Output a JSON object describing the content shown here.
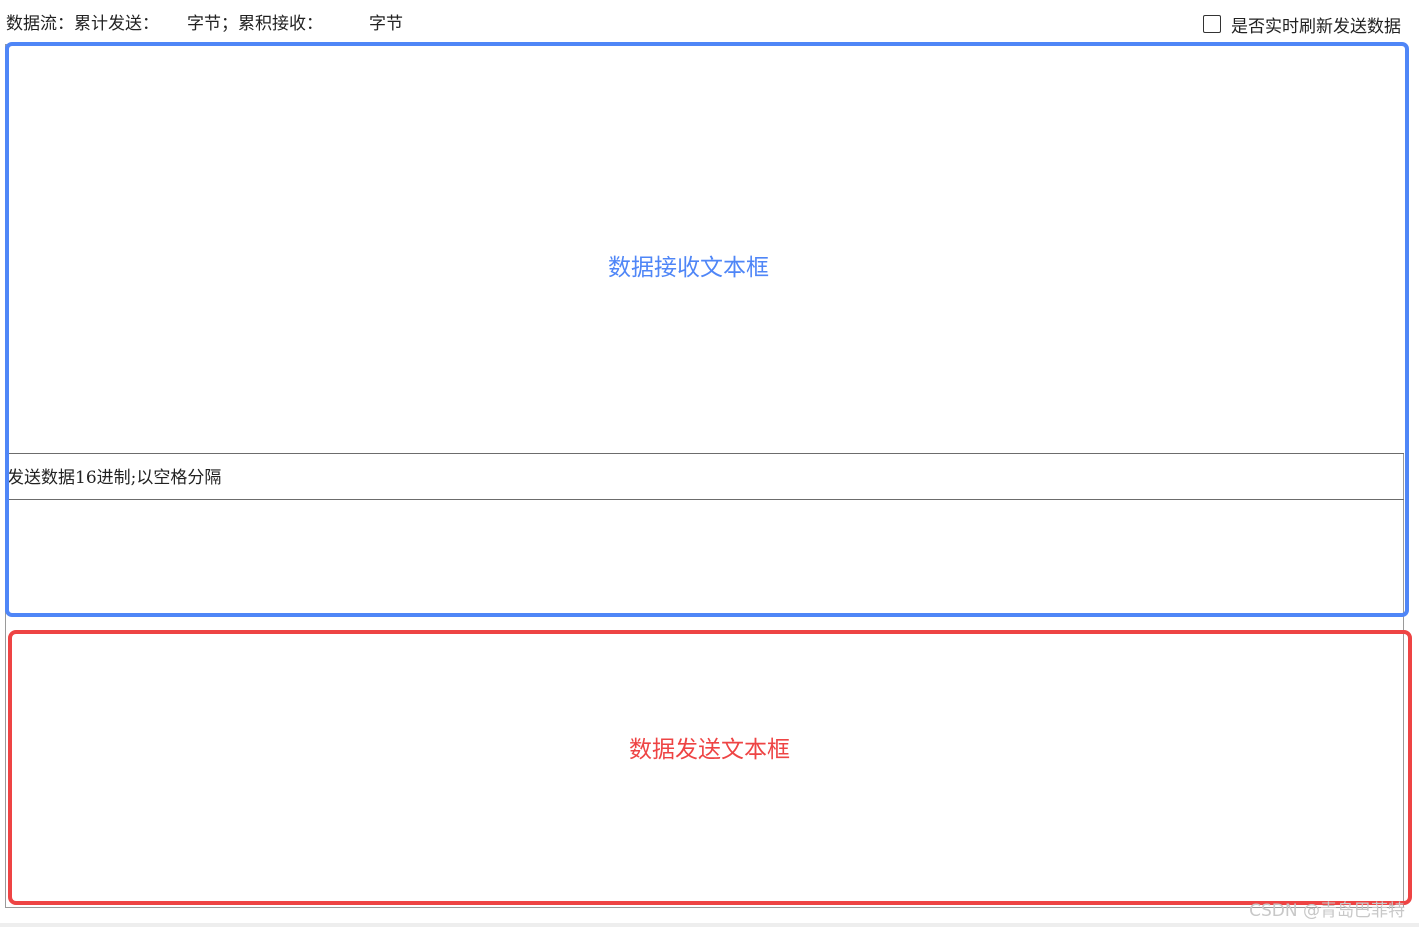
{
  "status": {
    "prefix": "数据流：",
    "sent_label": "累计发送：",
    "sent_unit": "字节；",
    "received_label": "累积接收：",
    "received_unit": "字节"
  },
  "refresh_toggle": {
    "label": "是否实时刷新发送数据",
    "checked": false
  },
  "send_section": {
    "label": "发送数据16进制;以空格分隔"
  },
  "annotations": {
    "receive_caption": "数据接收文本框",
    "receive_color": "#4f86f7",
    "send_caption": "数据发送文本框",
    "send_color": "#ee4444"
  },
  "watermark": "CSDN @青岛巴菲特"
}
